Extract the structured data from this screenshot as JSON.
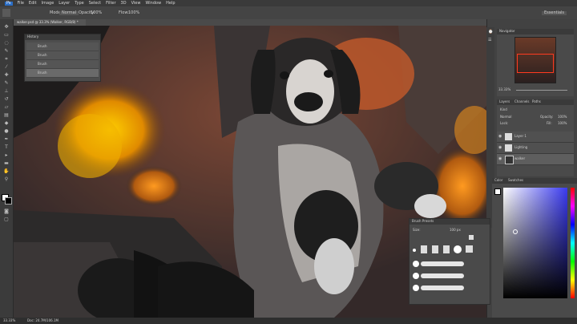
{
  "menu": [
    "Ps",
    "File",
    "Edit",
    "Image",
    "Layer",
    "Type",
    "Select",
    "Filter",
    "3D",
    "View",
    "Window",
    "Help"
  ],
  "options": {
    "mode_label": "Mode:",
    "mode_value": "Normal",
    "opacity_label": "Opacity:",
    "opacity_value": "100%",
    "flow_label": "Flow:",
    "flow_value": "100%",
    "essentials": "Essentials"
  },
  "document": {
    "tab_title": "walker.psd @ 33.3% (Walker, RGB/8) *"
  },
  "history": {
    "title": "History",
    "items": [
      "Brush",
      "Brush",
      "Brush",
      "Brush"
    ]
  },
  "navigator": {
    "title": "Navigator",
    "zoom": "33.33%"
  },
  "layers": {
    "tabs": [
      "Layers",
      "Channels",
      "Paths"
    ],
    "kind": "Kind",
    "blend": "Normal",
    "opacity_label": "Opacity:",
    "opacity_value": "100%",
    "lock_label": "Lock:",
    "fill_label": "Fill:",
    "fill_value": "100%",
    "items": [
      "Layer 1",
      "Lighting",
      "walker"
    ]
  },
  "color": {
    "tabs": [
      "Color",
      "Swatches"
    ]
  },
  "brush_presets": {
    "title": "Brush Presets",
    "size_label": "Size:",
    "size_value": "100 px"
  },
  "status": {
    "zoom": "33.33%",
    "doc": "Doc: 24.7M/106.1M"
  },
  "colors": {
    "accent": "#ff6a00",
    "fg": "#ffffff",
    "bg": "#000000"
  }
}
